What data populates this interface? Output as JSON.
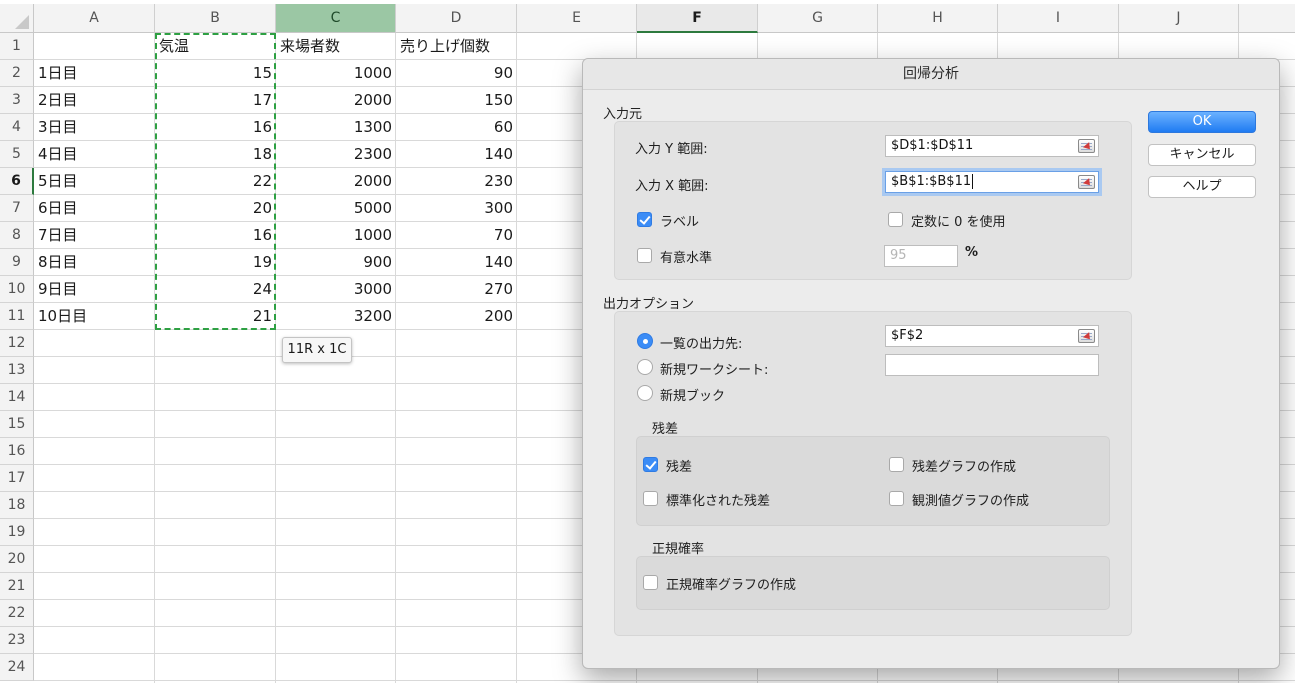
{
  "spreadsheet": {
    "columns": [
      "A",
      "B",
      "C",
      "D",
      "E",
      "F",
      "G",
      "H",
      "I",
      "J"
    ],
    "rows": [
      "1",
      "2",
      "3",
      "4",
      "5",
      "6",
      "7",
      "8",
      "9",
      "10",
      "11",
      "12",
      "13",
      "14",
      "15",
      "16",
      "17",
      "18",
      "19",
      "20",
      "21",
      "22",
      "23",
      "24"
    ],
    "headers": {
      "b": "気温",
      "c": "来場者数",
      "d": "売り上げ個数"
    },
    "data": [
      {
        "day": "1日目",
        "temp": "15",
        "visitors": "1000",
        "sales": "90"
      },
      {
        "day": "2日目",
        "temp": "17",
        "visitors": "2000",
        "sales": "150"
      },
      {
        "day": "3日目",
        "temp": "16",
        "visitors": "1300",
        "sales": "60"
      },
      {
        "day": "4日目",
        "temp": "18",
        "visitors": "2300",
        "sales": "140"
      },
      {
        "day": "5日目",
        "temp": "22",
        "visitors": "2000",
        "sales": "230"
      },
      {
        "day": "6日目",
        "temp": "20",
        "visitors": "5000",
        "sales": "300"
      },
      {
        "day": "7日目",
        "temp": "16",
        "visitors": "1000",
        "sales": "70"
      },
      {
        "day": "8日目",
        "temp": "19",
        "visitors": "900",
        "sales": "140"
      },
      {
        "day": "9日目",
        "temp": "24",
        "visitors": "3000",
        "sales": "270"
      },
      {
        "day": "10日目",
        "temp": "21",
        "visitors": "3200",
        "sales": "200"
      }
    ],
    "selection_tooltip": "11R x 1C"
  },
  "dialog": {
    "title": "回帰分析",
    "input_section": "入力元",
    "input_y_label": "入力 Y 範囲:",
    "input_y_value": "$D$1:$D$11",
    "input_x_label": "入力 X 範囲:",
    "input_x_value": "$B$1:$B$11",
    "labels_option": "ラベル",
    "constant_zero_option": "定数に 0 を使用",
    "confidence_option": "有意水準",
    "confidence_value": "95",
    "percent_sign": "%",
    "output_section": "出力オプション",
    "output_range_option": "一覧の出力先:",
    "output_range_value": "$F$2",
    "new_worksheet_option": "新規ワークシート:",
    "new_worksheet_value": "",
    "new_workbook_option": "新規ブック",
    "residuals_section": "残差",
    "residuals_option": "残差",
    "residual_plots_option": "残差グラフの作成",
    "standardized_residuals_option": "標準化された残差",
    "line_fit_plots_option": "観測値グラフの作成",
    "normal_probability_section": "正規確率",
    "normal_probability_plots_option": "正規確率グラフの作成",
    "ok_label": "OK",
    "cancel_label": "キャンセル",
    "help_label": "ヘルプ"
  }
}
